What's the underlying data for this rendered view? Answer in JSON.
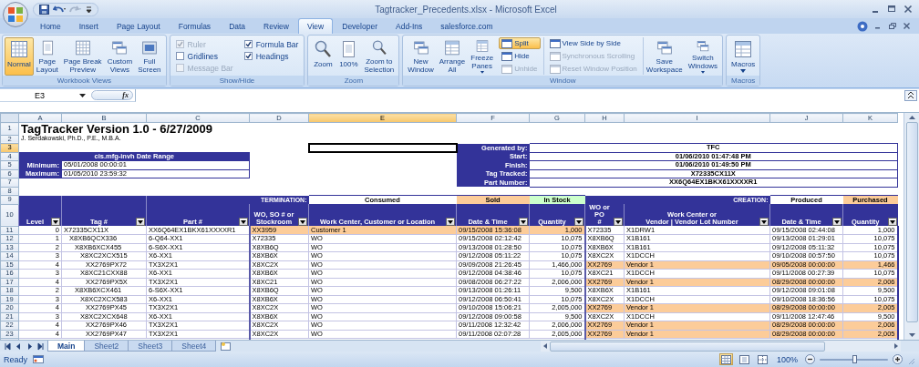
{
  "window": {
    "title": "Tagtracker_Precedents.xlsx - Microsoft Excel"
  },
  "tabs": [
    {
      "label": "Home",
      "selected": false
    },
    {
      "label": "Insert",
      "selected": false
    },
    {
      "label": "Page Layout",
      "selected": false
    },
    {
      "label": "Formulas",
      "selected": false
    },
    {
      "label": "Data",
      "selected": false
    },
    {
      "label": "Review",
      "selected": false
    },
    {
      "label": "View",
      "selected": true
    },
    {
      "label": "Developer",
      "selected": false
    },
    {
      "label": "Add-Ins",
      "selected": false
    },
    {
      "label": "salesforce.com",
      "selected": false
    }
  ],
  "ribbon": {
    "groups": [
      {
        "label": "Workbook Views",
        "items": [
          {
            "kind": "large",
            "label": "Normal",
            "selected": true
          },
          {
            "kind": "large",
            "label": "Page\nLayout",
            "selected": false
          },
          {
            "kind": "large",
            "label": "Page Break\nPreview",
            "selected": false
          },
          {
            "kind": "large",
            "label": "Custom\nViews",
            "selected": false
          },
          {
            "kind": "large",
            "label": "Full\nScreen",
            "selected": false
          }
        ]
      },
      {
        "label": "Show/Hide",
        "items": [
          {
            "kind": "checks",
            "items": [
              {
                "label": "Ruler",
                "checked": true,
                "disabled": true
              },
              {
                "label": "Gridlines",
                "checked": false,
                "disabled": false
              },
              {
                "label": "Message Bar",
                "checked": false,
                "disabled": true
              },
              {
                "label": "Formula Bar",
                "checked": true,
                "disabled": false
              },
              {
                "label": "Headings",
                "checked": true,
                "disabled": false
              }
            ]
          }
        ]
      },
      {
        "label": "Zoom",
        "items": [
          {
            "kind": "large",
            "label": "Zoom"
          },
          {
            "kind": "large",
            "label": "100%"
          },
          {
            "kind": "large",
            "label": "Zoom to\nSelection"
          }
        ]
      },
      {
        "label": "Window",
        "items": [
          {
            "kind": "large",
            "label": "New\nWindow"
          },
          {
            "kind": "large",
            "label": "Arrange\nAll"
          },
          {
            "kind": "large",
            "label": "Freeze\nPanes",
            "dropdown": true
          },
          {
            "kind": "stack",
            "items": [
              {
                "label": "Split",
                "on": true,
                "disabled": false
              },
              {
                "label": "Hide",
                "on": false,
                "disabled": false
              },
              {
                "label": "Unhide",
                "on": false,
                "disabled": true
              }
            ]
          },
          {
            "kind": "stack",
            "items": [
              {
                "label": "View Side by Side",
                "on": false,
                "disabled": false
              },
              {
                "label": "Synchronous Scrolling",
                "on": false,
                "disabled": true
              },
              {
                "label": "Reset Window Position",
                "on": false,
                "disabled": true
              }
            ]
          },
          {
            "kind": "large",
            "label": "Save\nWorkspace"
          },
          {
            "kind": "large",
            "label": "Switch\nWindows",
            "dropdown": true
          }
        ]
      },
      {
        "label": "Macros",
        "items": [
          {
            "kind": "large",
            "label": "Macros",
            "dropdown": true
          }
        ]
      }
    ]
  },
  "formula_bar": {
    "name_box": "E3",
    "function_label": "fx"
  },
  "sheet": {
    "columns": [
      {
        "letter": "A",
        "selected": false
      },
      {
        "letter": "B",
        "selected": false
      },
      {
        "letter": "C",
        "selected": false
      },
      {
        "letter": "D",
        "selected": false
      },
      {
        "letter": "E",
        "selected": true
      },
      {
        "letter": "F",
        "selected": false
      },
      {
        "letter": "G",
        "selected": false
      },
      {
        "letter": "H",
        "selected": false
      },
      {
        "letter": "I",
        "selected": false
      },
      {
        "letter": "J",
        "selected": false
      },
      {
        "letter": "K",
        "selected": false
      }
    ],
    "row_numbers": [
      {
        "label": "1",
        "selected": false
      },
      {
        "label": "2",
        "selected": false
      },
      {
        "label": "3",
        "selected": true
      },
      {
        "label": "4",
        "selected": false
      },
      {
        "label": "5",
        "selected": false
      },
      {
        "label": "6",
        "selected": false
      },
      {
        "label": "7",
        "selected": false
      },
      {
        "label": "8",
        "selected": false
      },
      {
        "label": "9",
        "selected": false
      },
      {
        "label": "10",
        "selected": false
      },
      {
        "label": "11",
        "selected": false
      },
      {
        "label": "12",
        "selected": false
      },
      {
        "label": "13",
        "selected": false
      },
      {
        "label": "14",
        "selected": false
      },
      {
        "label": "15",
        "selected": false
      },
      {
        "label": "16",
        "selected": false
      },
      {
        "label": "17",
        "selected": false
      },
      {
        "label": "18",
        "selected": false
      },
      {
        "label": "19",
        "selected": false
      },
      {
        "label": "20",
        "selected": false
      },
      {
        "label": "21",
        "selected": false
      },
      {
        "label": "22",
        "selected": false
      },
      {
        "label": "23",
        "selected": false
      }
    ],
    "title": "TagTracker Version 1.0 - 6/27/2009",
    "author": "J. Serdakowski, Ph.D., P.E., M.B.A.",
    "date_range": {
      "title": "cis.mfg-invh Date Range",
      "rows": [
        {
          "label": "Minimum:",
          "value": "05/01/2008 00:00:01"
        },
        {
          "label": "Maximum:",
          "value": "01/05/2010 23:59:32"
        }
      ]
    },
    "run_info": [
      {
        "label": "Generated by:",
        "value": "TFC"
      },
      {
        "label": "Start:",
        "value": "01/06/2010 01:47:48 PM"
      },
      {
        "label": "Finish:",
        "value": "01/06/2010 01:49:50 PM"
      },
      {
        "label": "Tag Tracked:",
        "value": "X72335CX11X"
      },
      {
        "label": "Part Number:",
        "value": "XX6Q64EX1BKX61XXXXR1"
      }
    ],
    "group_headers": [
      {
        "text": "TERMINATION:",
        "kind": "label",
        "color": "#333399"
      },
      {
        "text": "Consumed",
        "kind": "status",
        "color": "#ffffff"
      },
      {
        "text": "Sold",
        "kind": "status",
        "color": "#fccc99"
      },
      {
        "text": "In Stock",
        "kind": "status",
        "color": "#ccffcc"
      },
      {
        "text": "CREATION:",
        "kind": "label",
        "color": "#333399"
      },
      {
        "text": "Produced",
        "kind": "status",
        "color": "#ffffff"
      },
      {
        "text": "Purchased",
        "kind": "status",
        "color": "#fccc99"
      }
    ],
    "headers": [
      {
        "text": "Level",
        "kind": "tall"
      },
      {
        "text": "Tag #",
        "kind": "tall"
      },
      {
        "text": "Part #",
        "kind": "tall"
      },
      {
        "text": "WO, SO # or\nStockroom",
        "kind": "column"
      },
      {
        "text": "Work Center, Customer or Location",
        "kind": "column"
      },
      {
        "text": "Date & Time",
        "kind": "column"
      },
      {
        "text": "Quantity",
        "kind": "column"
      },
      {
        "text": "WO or PO\n#",
        "kind": "column"
      },
      {
        "text": "Work Center or\nVendor | Vendor Lot Number",
        "kind": "column"
      },
      {
        "text": "Date & Time",
        "kind": "column"
      },
      {
        "text": "Quantity",
        "kind": "column"
      }
    ],
    "rows": [
      {
        "level": "0",
        "tag": "X72335CX11X",
        "part": "XX6Q64EX1BKX61XXXXR1",
        "consumed_by": "XX3959",
        "location": "Customer 1",
        "sold_date": "09/15/2008 15:36:08",
        "sold_qty": "1,000",
        "source": "X72335",
        "vendor": "X1DRW1",
        "produced_date": "09/15/2008 02:44:08",
        "produced_qty": "1,000",
        "sold": true,
        "purchased": false
      },
      {
        "level": "1",
        "tag": "X8XB6QCX336",
        "part": "6-Q64-XX1",
        "consumed_by": "X72335",
        "location": "WO",
        "sold_date": "09/15/2008 02:12:42",
        "sold_qty": "10,075",
        "source": "X8XB6Q",
        "vendor": "X1B161",
        "produced_date": "09/13/2008 01:29:01",
        "produced_qty": "10,075",
        "sold": false,
        "purchased": false
      },
      {
        "level": "2",
        "tag": "X8XB6XCX455",
        "part": "6-S6X-XX1",
        "consumed_by": "X8XB6Q",
        "location": "WO",
        "sold_date": "09/13/2008 01:28:50",
        "sold_qty": "10,075",
        "source": "X8XB6X",
        "vendor": "X1B161",
        "produced_date": "09/12/2008 05:11:32",
        "produced_qty": "10,075",
        "sold": false,
        "purchased": false
      },
      {
        "level": "3",
        "tag": "X8XC2XCX515",
        "part": "X6-XX1",
        "consumed_by": "X8XB6X",
        "location": "WO",
        "sold_date": "09/12/2008 05:11:22",
        "sold_qty": "10,075",
        "source": "X8XC2X",
        "vendor": "X1DCCH",
        "produced_date": "09/10/2008 00:57:50",
        "produced_qty": "10,075",
        "sold": false,
        "purchased": false
      },
      {
        "level": "4",
        "tag": "XX2769PX72",
        "part": "TX3X2X1",
        "consumed_by": "X8XC2X",
        "location": "WO",
        "sold_date": "09/09/2008 21:26:45",
        "sold_qty": "1,466,000",
        "source": "XX2769",
        "vendor": "Vendor 1",
        "produced_date": "09/05/2008 00:00:00",
        "produced_qty": "1,466",
        "sold": false,
        "purchased": true
      },
      {
        "level": "3",
        "tag": "X8XC21CXX88",
        "part": "X6-XX1",
        "consumed_by": "X8XB6X",
        "location": "WO",
        "sold_date": "09/12/2008 04:38:46",
        "sold_qty": "10,075",
        "source": "X8XC21",
        "vendor": "X1DCCH",
        "produced_date": "09/11/2008 00:27:39",
        "produced_qty": "10,075",
        "sold": false,
        "purchased": false
      },
      {
        "level": "4",
        "tag": "XX2769PX5X",
        "part": "TX3X2X1",
        "consumed_by": "X8XC21",
        "location": "WO",
        "sold_date": "09/08/2008 06:27:22",
        "sold_qty": "2,006,000",
        "source": "XX2769",
        "vendor": "Vendor 1",
        "produced_date": "08/29/2008 00:00:00",
        "produced_qty": "2,006",
        "sold": false,
        "purchased": true
      },
      {
        "level": "2",
        "tag": "X8XB6XCX461",
        "part": "6-S6X-XX1",
        "consumed_by": "X8XB6Q",
        "location": "WO",
        "sold_date": "09/13/2008 01:26:11",
        "sold_qty": "9,500",
        "source": "X8XB6X",
        "vendor": "X1B161",
        "produced_date": "09/12/2008 09:01:08",
        "produced_qty": "9,500",
        "sold": false,
        "purchased": false
      },
      {
        "level": "3",
        "tag": "X8XC2XCX583",
        "part": "X6-XX1",
        "consumed_by": "X8XB6X",
        "location": "WO",
        "sold_date": "09/12/2008 06:50:41",
        "sold_qty": "10,075",
        "source": "X8XC2X",
        "vendor": "X1DCCH",
        "produced_date": "09/10/2008 18:36:56",
        "produced_qty": "10,075",
        "sold": false,
        "purchased": false
      },
      {
        "level": "4",
        "tag": "XX2769PX45",
        "part": "TX3X2X1",
        "consumed_by": "X8XC2X",
        "location": "WO",
        "sold_date": "09/10/2008 15:06:21",
        "sold_qty": "2,005,000",
        "source": "XX2769",
        "vendor": "Vendor 1",
        "produced_date": "08/29/2008 00:00:00",
        "produced_qty": "2,005",
        "sold": false,
        "purchased": true
      },
      {
        "level": "3",
        "tag": "X8XC2XCX648",
        "part": "X6-XX1",
        "consumed_by": "X8XB6X",
        "location": "WO",
        "sold_date": "09/12/2008 09:00:58",
        "sold_qty": "9,500",
        "source": "X8XC2X",
        "vendor": "X1DCCH",
        "produced_date": "09/11/2008 12:47:46",
        "produced_qty": "9,500",
        "sold": false,
        "purchased": false
      },
      {
        "level": "4",
        "tag": "XX2769PX46",
        "part": "TX3X2X1",
        "consumed_by": "X8XC2X",
        "location": "WO",
        "sold_date": "09/11/2008 12:32:42",
        "sold_qty": "2,006,000",
        "source": "XX2769",
        "vendor": "Vendor 1",
        "produced_date": "08/29/2008 00:00:00",
        "produced_qty": "2,006",
        "sold": false,
        "purchased": true
      },
      {
        "level": "4",
        "tag": "XX2769PX47",
        "part": "TX3X2X1",
        "consumed_by": "X8XC2X",
        "location": "WO",
        "sold_date": "09/11/2008 02:07:28",
        "sold_qty": "2,005,000",
        "source": "XX2769",
        "vendor": "Vendor 1",
        "produced_date": "08/29/2008 00:00:00",
        "produced_qty": "2,005",
        "sold": false,
        "purchased": true
      }
    ]
  },
  "sheet_tabs": [
    {
      "label": "Main",
      "selected": true
    },
    {
      "label": "Sheet2",
      "selected": false
    },
    {
      "label": "Sheet3",
      "selected": false
    },
    {
      "label": "Sheet4",
      "selected": false
    }
  ],
  "status_bar": {
    "text": "Ready",
    "view_buttons": [
      {
        "selected": true
      },
      {
        "selected": false
      },
      {
        "selected": false
      }
    ],
    "zoom": {
      "label": "100%",
      "level": 0.5
    }
  }
}
